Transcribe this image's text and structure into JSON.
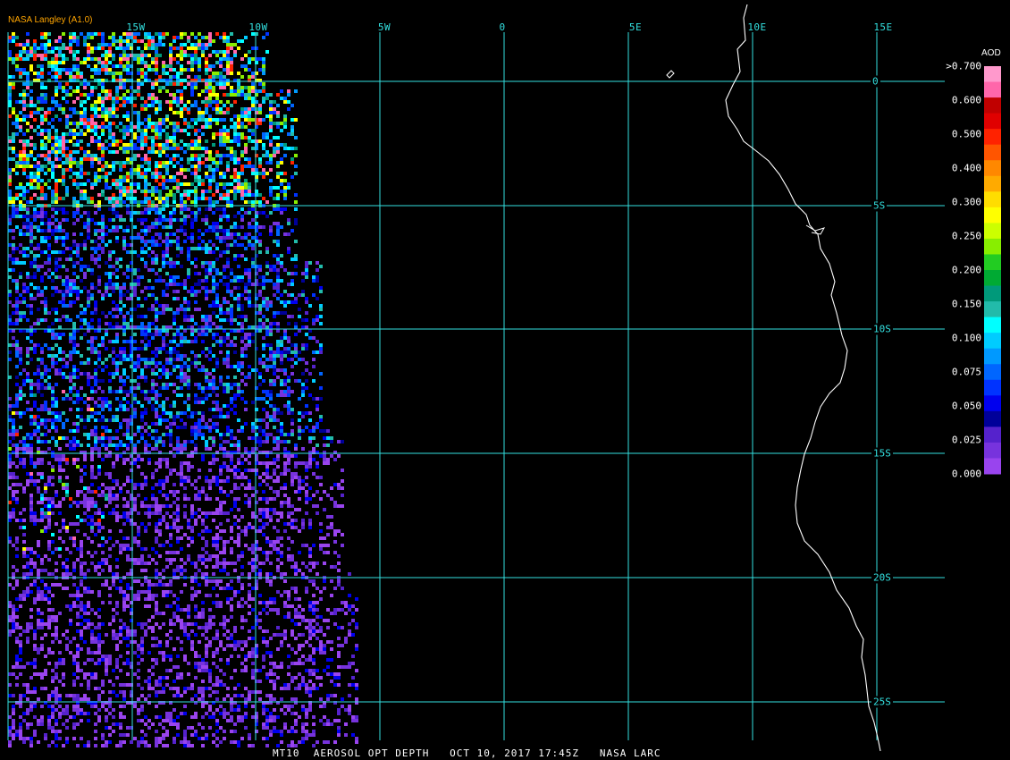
{
  "credit": "NASA Langley (A1.0)",
  "footer": "MT10  AEROSOL OPT DEPTH   OCT 10, 2017 17:45Z   NASA LARC",
  "legend": {
    "title": "AOD",
    "labels": [
      ">0.700",
      "0.600",
      "0.500",
      "0.400",
      "0.300",
      "0.250",
      "0.200",
      "0.150",
      "0.100",
      "0.075",
      "0.050",
      "0.025",
      "0.000"
    ],
    "colors": [
      "#ff99cc",
      "#ff66aa",
      "#c00000",
      "#e00000",
      "#ff2200",
      "#ff5500",
      "#ff8800",
      "#ffaa00",
      "#ffdd00",
      "#ffff00",
      "#ccff00",
      "#88ee00",
      "#22cc22",
      "#00aa33",
      "#00997a",
      "#22bbaa",
      "#00ffff",
      "#00ccff",
      "#0099ff",
      "#0066ff",
      "#0033ff",
      "#0000ee",
      "#000099",
      "#5522cc",
      "#7733dd",
      "#9944ee"
    ]
  },
  "grid": {
    "longitudes": [
      "15W",
      "10W",
      "5W",
      "0",
      "5E",
      "10E",
      "15E"
    ],
    "latitudes": [
      "0",
      "5S",
      "10S",
      "15S",
      "20S",
      "25S"
    ],
    "line_color": "#33e0e0"
  },
  "coast_color": "#ffffff"
}
